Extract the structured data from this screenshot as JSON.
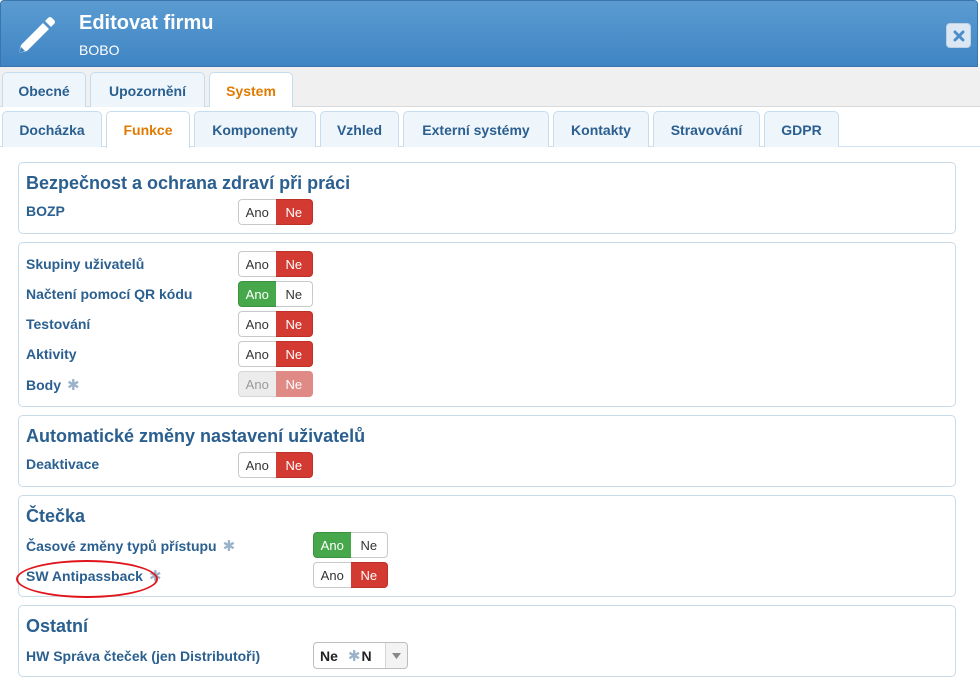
{
  "header": {
    "title": "Editovat firmu",
    "subtitle": "BOBO",
    "icon": "pencil-icon",
    "close_icon": "close-icon"
  },
  "tabs_main": [
    {
      "label": "Obecné",
      "active": false
    },
    {
      "label": "Upozornění",
      "active": false
    },
    {
      "label": "System",
      "active": true
    }
  ],
  "tabs_sub": [
    {
      "label": "Docházka",
      "active": false
    },
    {
      "label": "Funkce",
      "active": true
    },
    {
      "label": "Komponenty",
      "active": false
    },
    {
      "label": "Vzhled",
      "active": false
    },
    {
      "label": "Externí systémy",
      "active": false
    },
    {
      "label": "Kontakty",
      "active": false
    },
    {
      "label": "Stravování",
      "active": false
    },
    {
      "label": "GDPR",
      "active": false
    }
  ],
  "toggle_labels": {
    "yes": "Ano",
    "no": "Ne"
  },
  "sections": {
    "bozp": {
      "title": "Bezpečnost a ochrana zdraví při práci",
      "rows": [
        {
          "label": "BOZP",
          "value": "Ne"
        }
      ]
    },
    "general": {
      "rows": [
        {
          "label": "Skupiny uživatelů",
          "value": "Ne"
        },
        {
          "label": "Načtení pomocí QR kódu",
          "value": "Ano"
        },
        {
          "label": "Testování",
          "value": "Ne"
        },
        {
          "label": "Aktivity",
          "value": "Ne"
        },
        {
          "label": "Body",
          "value": "Ne",
          "disabled": true,
          "marker": "✱"
        }
      ]
    },
    "auto": {
      "title": "Automatické změny nastavení uživatelů",
      "rows": [
        {
          "label": "Deaktivace",
          "value": "Ne"
        }
      ]
    },
    "reader": {
      "title": "Čtečka",
      "rows": [
        {
          "label": "Časové změny typů přístupu",
          "value": "Ano",
          "marker": "✱"
        },
        {
          "label": "SW Antipassback",
          "value": "Ne",
          "marker": "✱",
          "highlighted": true
        }
      ]
    },
    "other": {
      "title": "Ostatní",
      "rows": [
        {
          "label": "HW Správa čteček (jen Distributoři)",
          "select_value": "Ne",
          "select_suffix": "N",
          "marker": "✱"
        }
      ]
    }
  },
  "colors": {
    "header": "#4a8fcb",
    "active_tab": "#e07b00",
    "toggle_no": "#d33a32",
    "toggle_yes": "#46a84b",
    "highlight_circle": "#e0151c"
  }
}
